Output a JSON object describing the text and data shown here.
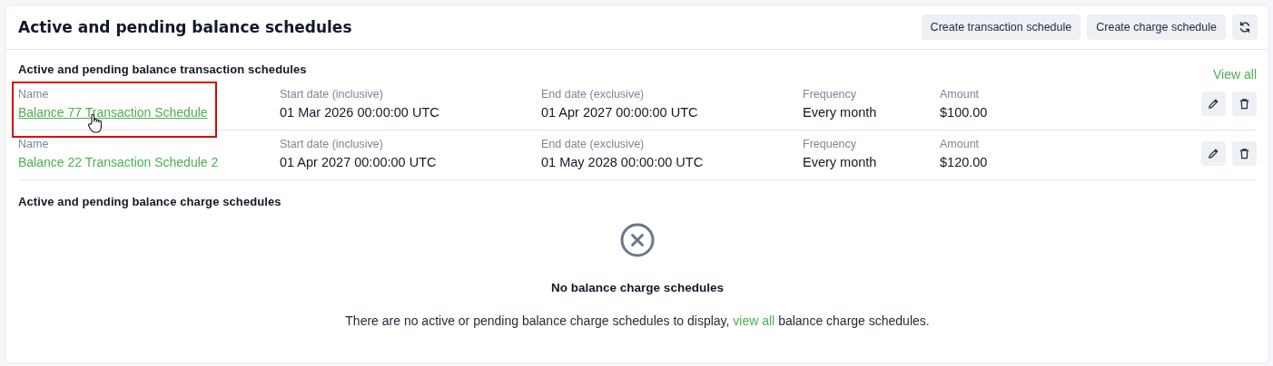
{
  "card": {
    "title": "Active and pending balance schedules",
    "buttons": [
      {
        "kind": "text",
        "label": "Create transaction schedule"
      },
      {
        "kind": "text",
        "label": "Create charge schedule"
      },
      {
        "kind": "refresh"
      }
    ]
  },
  "transaction_schedules": {
    "title": "Active and pending balance transaction schedules",
    "view_all": "View all",
    "rows": [
      {
        "name_label": "Name",
        "name": "Balance 77 Transaction Schedule",
        "highlighted": true,
        "hovered": true,
        "start_label": "Start date (inclusive)",
        "start": "01 Mar 2026 00:00:00 UTC",
        "end_label": "End date (exclusive)",
        "end": "01 Apr 2027 00:00:00 UTC",
        "frequency_label": "Frequency",
        "frequency": "Every month",
        "amount_label": "Amount",
        "amount": "$100.00"
      },
      {
        "name_label": "Name",
        "name": "Balance 22 Transaction Schedule 2",
        "highlighted": false,
        "hovered": false,
        "start_label": "Start date (inclusive)",
        "start": "01 Apr 2027 00:00:00 UTC",
        "end_label": "End date (exclusive)",
        "end": "01 May 2028 00:00:00 UTC",
        "frequency_label": "Frequency",
        "frequency": "Every month",
        "amount_label": "Amount",
        "amount": "$120.00"
      }
    ]
  },
  "charge_schedules": {
    "title": "Active and pending balance charge schedules",
    "empty": {
      "title": "No balance charge schedules",
      "text_before": "There are no active or pending balance charge schedules to display,",
      "link": "view all",
      "text_after": "balance charge schedules."
    }
  }
}
